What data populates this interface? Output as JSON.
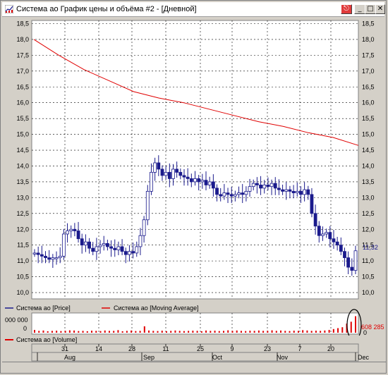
{
  "window": {
    "title": "Система ао График цены и объёма #2 - [Дневной]"
  },
  "colors": {
    "price": "#1a1a8c",
    "moving_average": "#e00000",
    "volume": "#e00000",
    "grid": "#000000",
    "current_price_label": "#1a1a8c"
  },
  "price_panel": {
    "left_ticks": [
      "18,5",
      "18,0",
      "17,5",
      "17,0",
      "16,5",
      "16,0",
      "15,5",
      "15,0",
      "14,5",
      "14,0",
      "13,5",
      "13,0",
      "12,5",
      "12,0",
      "11,5",
      "11,0",
      "10,5",
      "10,0"
    ],
    "right_ticks": [
      "18,5",
      "18,0",
      "17,5",
      "17,0",
      "16,5",
      "16,0",
      "15,5",
      "15,0",
      "14,5",
      "14,0",
      "13,5",
      "13,0",
      "12,5",
      "12,0",
      "11,5",
      "11,0",
      "10,5",
      "10,0"
    ],
    "current_price": "11,32",
    "legend_price": "Система ао [Price]",
    "legend_ma": "Система ао [Moving Average]"
  },
  "volume_panel": {
    "left_ticks": [
      "000 000",
      "0"
    ],
    "current_volume": "608 285",
    "current_volume_unit": "0",
    "legend_volume": "Система ао [Volume]"
  },
  "time_axis": {
    "days": [
      "31",
      "14",
      "28",
      "11",
      "25",
      "9",
      "23",
      "7",
      "20"
    ],
    "months": [
      "Aug",
      "Sep",
      "Oct",
      "Nov",
      "Dec"
    ]
  },
  "chart_data": {
    "type": "line",
    "ylim": [
      9.8,
      18.6
    ],
    "series": [
      {
        "name": "Система ао [Price]",
        "values": [
          11.25,
          11.2,
          11.15,
          11.1,
          11.05,
          11.1,
          11.1,
          11.15,
          11.85,
          11.95,
          12.0,
          11.95,
          11.7,
          11.5,
          11.6,
          11.4,
          11.3,
          11.45,
          11.5,
          11.55,
          11.45,
          11.4,
          11.35,
          11.45,
          11.3,
          11.2,
          11.3,
          11.25,
          11.45,
          11.8,
          12.3,
          13.2,
          13.8,
          14.1,
          13.9,
          13.7,
          13.8,
          13.6,
          13.9,
          13.8,
          13.7,
          13.65,
          13.6,
          13.5,
          13.6,
          13.5,
          13.55,
          13.4,
          13.5,
          13.3,
          13.1,
          13.05,
          13.15,
          13.1,
          13.05,
          13.1,
          13.15,
          13.1,
          13.2,
          13.35,
          13.45,
          13.4,
          13.3,
          13.4,
          13.35,
          13.45,
          13.3,
          13.25,
          13.2,
          13.25,
          13.2,
          13.15,
          13.2,
          13.1,
          13.25,
          13.1,
          12.5,
          12.1,
          11.8,
          11.85,
          11.9,
          11.7,
          11.6,
          11.5,
          11.3,
          11.1,
          10.8,
          10.7,
          11.32
        ]
      },
      {
        "name": "Система ао [Moving Average]",
        "values": [
          18.0,
          17.5,
          17.05,
          16.7,
          16.35,
          16.15,
          16.0,
          15.8,
          15.6,
          15.4,
          15.25,
          15.05,
          14.9,
          14.65
        ]
      },
      {
        "name": "Система ао [Volume]",
        "values": [
          0.15,
          0.1,
          0.12,
          0.08,
          0.1,
          0.11,
          0.09,
          0.1,
          0.13,
          0.12,
          0.09,
          0.1,
          0.08,
          0.11,
          0.1,
          0.09,
          0.12,
          0.1,
          0.1,
          0.14,
          0.08,
          0.1,
          0.12,
          0.09,
          0.1,
          0.35,
          0.12,
          0.1,
          0.09,
          0.11,
          0.08,
          0.1,
          0.12,
          0.1,
          0.09,
          0.1,
          0.11,
          0.1,
          0.08,
          0.12,
          0.1,
          0.11,
          0.09,
          0.1,
          0.13,
          0.1,
          0.12,
          0.1,
          0.09,
          0.11,
          0.1,
          0.12,
          0.1,
          0.1,
          0.13,
          0.1,
          0.12,
          0.1,
          0.09,
          0.11,
          0.1,
          0.14,
          0.12,
          0.1,
          0.11,
          0.1,
          0.12,
          0.15,
          0.2,
          0.25,
          0.3,
          0.5,
          0.6,
          0.9
        ]
      }
    ]
  }
}
